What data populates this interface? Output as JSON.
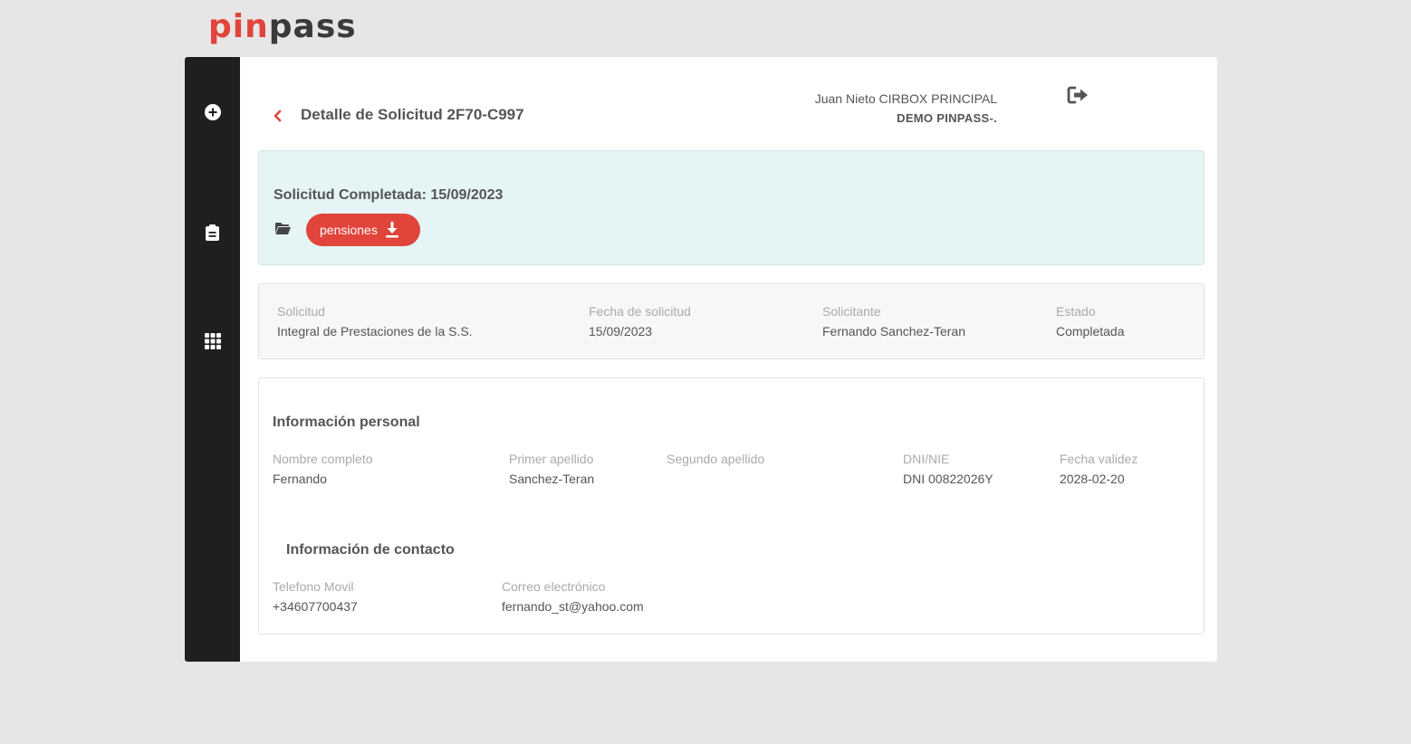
{
  "brand": {
    "logo_pin": "pin",
    "logo_pass": "pass",
    "primary_color": "#e0443a",
    "dark_color": "#1f1f1f"
  },
  "sidebar": {
    "items": [
      {
        "icon": "plus-circle-icon"
      },
      {
        "icon": "clipboard-icon"
      },
      {
        "icon": "grid-icon"
      }
    ]
  },
  "header": {
    "title": "Detalle de Solicitud 2F70-C997",
    "user_name": "Juan Nieto CIRBOX PRINCIPAL",
    "organization": "DEMO PINPASS-."
  },
  "status_card": {
    "text": "Solicitud Completada: 15/09/2023",
    "file_button_label": "pensiones",
    "background": "#e5f4f5"
  },
  "summary": {
    "solicitud_label": "Solicitud",
    "solicitud_value": "Integral de Prestaciones de la S.S.",
    "fecha_label": "Fecha de solicitud",
    "fecha_value": "15/09/2023",
    "solicitante_label": "Solicitante",
    "solicitante_value": "Fernando Sanchez-Teran",
    "estado_label": "Estado",
    "estado_value": "Completada"
  },
  "personal": {
    "title": "Información personal",
    "nombre_label": "Nombre completo",
    "nombre_value": "Fernando",
    "primer_label": "Primer apellido",
    "primer_value": "Sanchez-Teran",
    "segundo_label": "Segundo apellido",
    "segundo_value": "",
    "dni_label": "DNI/NIE",
    "dni_value": "DNI 00822026Y",
    "validez_label": "Fecha validez",
    "validez_value": "2028-02-20"
  },
  "contact": {
    "title": "Información de contacto",
    "telefono_label": "Telefono Movil",
    "telefono_value": "+34607700437",
    "correo_label": "Correo electrónico",
    "correo_value": "fernando_st@yahoo.com"
  }
}
